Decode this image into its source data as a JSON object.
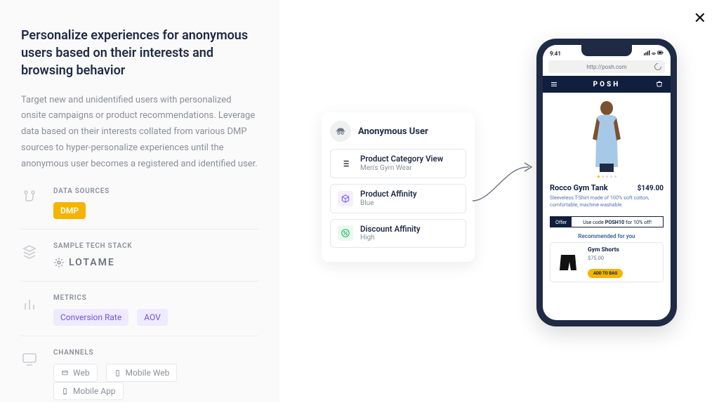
{
  "close_label": "✕",
  "left": {
    "title": "Personalize experiences for anonymous users based on their interests and browsing behavior",
    "description": "Target new and unidentified users with personalized onsite campaigns or product recommendations. Leverage data based on their interests collated from various DMP sources to hyper-personalize experiences until the anonymous user becomes a registered and identified user.",
    "data_sources": {
      "label": "DATA SOURCES",
      "items": [
        "DMP"
      ]
    },
    "sample_tech_stack": {
      "label": "SAMPLE TECH STACK",
      "logo_text": "LOTAME"
    },
    "metrics": {
      "label": "METRICS",
      "items": [
        "Conversion Rate",
        "AOV"
      ]
    },
    "channels": {
      "label": "CHANNELS",
      "items": [
        "Web",
        "Mobile Web",
        "Mobile App"
      ]
    }
  },
  "card": {
    "title": "Anonymous User",
    "rows": [
      {
        "title": "Product Category View",
        "sub": "Men's Gym Wear",
        "icon": "list"
      },
      {
        "title": "Product Affinity",
        "sub": "Blue",
        "icon": "box"
      },
      {
        "title": "Discount Affinity",
        "sub": "High",
        "icon": "disc"
      }
    ]
  },
  "phone": {
    "time": "9:41",
    "url": "http://posh.com",
    "store_name": "POSH",
    "product": {
      "name": "Rocco Gym Tank",
      "price": "$149.00",
      "desc": "Sleeveless T-Shirt made of 100% soft cotton, comfortable, machine washable."
    },
    "offer": {
      "tag": "Offer",
      "text_prefix": "Use code ",
      "code": "POSH10",
      "text_suffix": " for 10% off!"
    },
    "recommended": {
      "heading": "Recommended for you",
      "item": {
        "name": "Gym Shorts",
        "price": "$75.00",
        "cta": "ADD TO BAG"
      }
    }
  }
}
